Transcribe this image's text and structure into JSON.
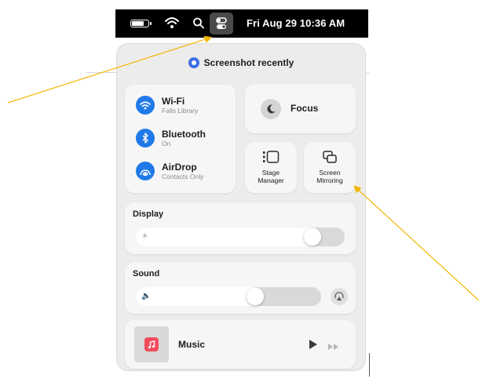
{
  "menubar": {
    "battery_level": 0.8,
    "clock": "Fri Aug 29  10:36 AM",
    "icons": [
      "battery-icon",
      "wifi-icon",
      "search-icon",
      "control-center-icon"
    ]
  },
  "control_center": {
    "recording_notice": "Screenshot recently",
    "network": [
      {
        "title": "Wi-Fi",
        "subtitle": "Falls Library",
        "icon": "wifi-icon"
      },
      {
        "title": "Bluetooth",
        "subtitle": "On",
        "icon": "bluetooth-icon"
      },
      {
        "title": "AirDrop",
        "subtitle": "Contacts Only",
        "icon": "airdrop-icon"
      }
    ],
    "focus_label": "Focus",
    "stage_manager": {
      "line1": "Stage",
      "line2": "Manager"
    },
    "screen_mirroring": {
      "line1": "Screen",
      "line2": "Mirroring"
    },
    "display": {
      "title": "Display",
      "brightness": 0.88
    },
    "sound": {
      "title": "Sound",
      "volume": 0.66
    },
    "now_playing": {
      "app": "Music"
    }
  },
  "colors": {
    "accent_blue": "#1f7ae8",
    "annotation_arrow": "#f2b600",
    "music_red": "#f14c5c",
    "panel_bg": "#ececec",
    "menubar_bg": "#000000"
  }
}
